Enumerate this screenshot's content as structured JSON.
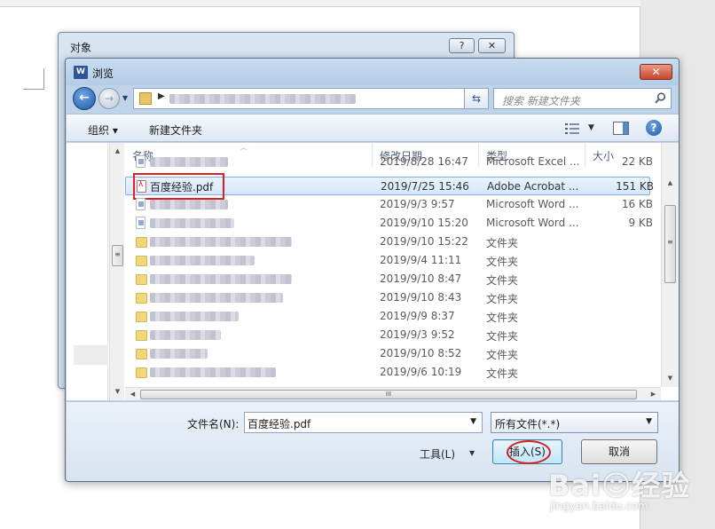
{
  "background_dialog": {
    "title": "对象",
    "help_label": "?",
    "close_label": "✕"
  },
  "dialog": {
    "title": "浏览",
    "app_icon_text": "W",
    "close_label": "✕"
  },
  "address": {
    "search_placeholder": "搜索 新建文件夹"
  },
  "toolbar": {
    "organize_label": "组织 ▾",
    "new_folder_label": "新建文件夹",
    "help_label": "?"
  },
  "columns": {
    "name": "名称",
    "date": "修改日期",
    "type": "类型",
    "size": "大小"
  },
  "files": [
    {
      "name": "",
      "date": "2019/8/28 16:47",
      "type": "Microsoft Excel ...",
      "size": "22 KB",
      "icon": "excel-icon"
    },
    {
      "name": "百度经验.pdf",
      "date": "2019/7/25 15:46",
      "type": "Adobe Acrobat ...",
      "size": "151 KB",
      "icon": "pdf-icon"
    },
    {
      "name": "",
      "date": "2019/9/3 9:57",
      "type": "Microsoft Word ...",
      "size": "16 KB",
      "icon": "word-doc-icon"
    },
    {
      "name": "",
      "date": "2019/9/10 15:20",
      "type": "Microsoft Word ...",
      "size": "9 KB",
      "icon": "word-doc-icon"
    },
    {
      "name": "",
      "date": "2019/9/10 15:22",
      "type": "文件夹",
      "size": "",
      "icon": "folder-icon"
    },
    {
      "name": "",
      "date": "2019/9/4 11:11",
      "type": "文件夹",
      "size": "",
      "icon": "folder-icon"
    },
    {
      "name": "",
      "date": "2019/9/10 8:47",
      "type": "文件夹",
      "size": "",
      "icon": "folder-icon"
    },
    {
      "name": "",
      "date": "2019/9/10 8:43",
      "type": "文件夹",
      "size": "",
      "icon": "folder-icon"
    },
    {
      "name": "",
      "date": "2019/9/9 8:37",
      "type": "文件夹",
      "size": "",
      "icon": "folder-icon"
    },
    {
      "name": "",
      "date": "2019/9/3 9:52",
      "type": "文件夹",
      "size": "",
      "icon": "folder-icon"
    },
    {
      "name": "",
      "date": "2019/9/10 8:52",
      "type": "文件夹",
      "size": "",
      "icon": "folder-icon"
    },
    {
      "name": "",
      "date": "2019/9/6 10:19",
      "type": "文件夹",
      "size": "",
      "icon": "folder-icon"
    }
  ],
  "bottom": {
    "filename_label": "文件名(N):",
    "filename_value": "百度经验.pdf",
    "filetype_value": "所有文件(*.*)",
    "tools_label": "工具(L)",
    "insert_label": "插入(S)",
    "cancel_label": "取消"
  },
  "watermark": {
    "logo": "Bai☺经验",
    "url": "jingyan.baidu.com"
  },
  "colors": {
    "accent_blue": "#1f5aa8",
    "highlight_red": "#e02020",
    "selection": "#d4e8fb"
  }
}
